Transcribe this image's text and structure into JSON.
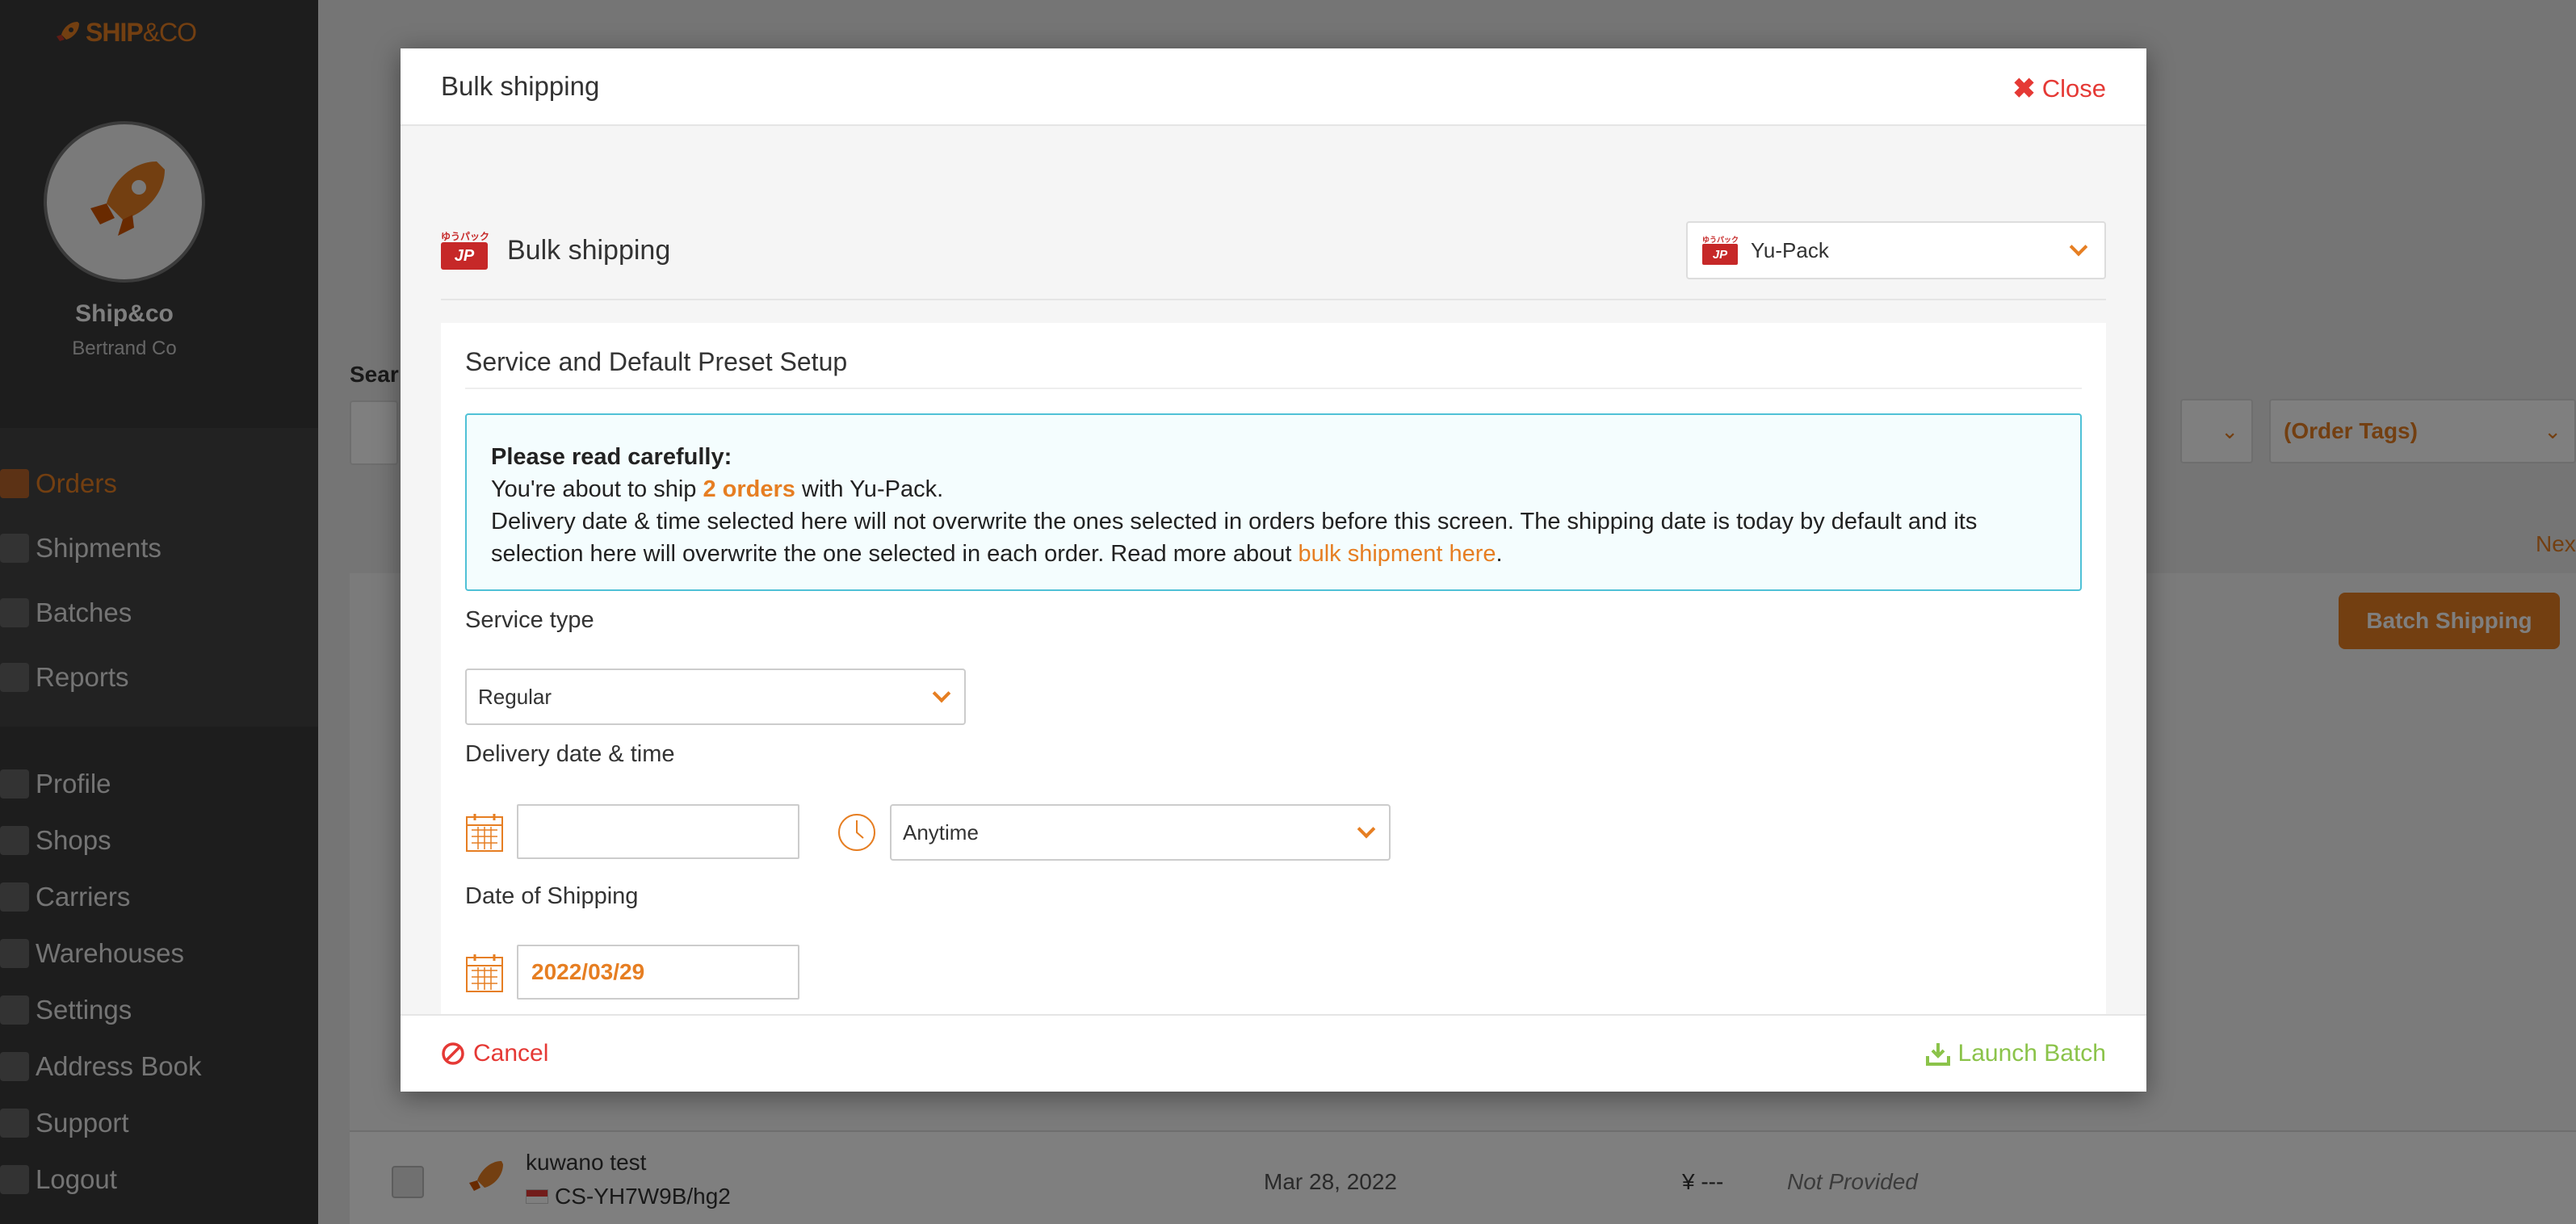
{
  "sidebar": {
    "logo_text_bold": "SHIP",
    "logo_text_rest": "&CO",
    "shop_name": "Ship&co",
    "shop_owner": "Bertrand Co",
    "nav_primary": [
      {
        "label": "Orders",
        "icon": "orders-icon",
        "active": true
      },
      {
        "label": "Shipments",
        "icon": "box-icon"
      },
      {
        "label": "Batches",
        "icon": "batch-icon"
      },
      {
        "label": "Reports",
        "icon": "report-icon"
      }
    ],
    "nav_secondary": [
      {
        "label": "Profile",
        "icon": "user-icon"
      },
      {
        "label": "Shops",
        "icon": "shop-icon"
      },
      {
        "label": "Carriers",
        "icon": "truck-icon"
      },
      {
        "label": "Warehouses",
        "icon": "warehouse-icon"
      },
      {
        "label": "Settings",
        "icon": "gear-icon"
      },
      {
        "label": "Address Book",
        "icon": "book-icon"
      },
      {
        "label": "Support",
        "icon": "help-icon"
      },
      {
        "label": "Logout",
        "icon": "logout-icon"
      }
    ]
  },
  "background": {
    "search_label": "Sear",
    "order_tags_placeholder": "(Order Tags)",
    "batch_shipping_label": "Batch Shipping",
    "next_label": "Nex",
    "order_row": {
      "name": "kuwano test",
      "code": "CS-YH7W9B/hg2",
      "date": "Mar 28, 2022",
      "price": "¥ ---",
      "status": "Not Provided"
    }
  },
  "modal": {
    "title": "Bulk shipping",
    "close_label": "Close",
    "carrier_heading": "Bulk shipping",
    "carrier_logo_top": "ゆうパック",
    "carrier_logo_box": "JP",
    "carrier_selected": "Yu-Pack",
    "section_title": "Service and Default Preset Setup",
    "notice": {
      "heading": "Please read carefully:",
      "line1_pre": "You're about to ship ",
      "line1_orders": "2 orders",
      "line1_post": " with Yu-Pack.",
      "line2_pre": "Delivery date & time selected here will not overwrite the ones selected in orders before this screen. The shipping date is today by default and its selection here will overwrite the one selected in each order. Read more about ",
      "line2_link": "bulk shipment here",
      "line2_post": "."
    },
    "service_type_label": "Service type",
    "service_type_value": "Regular",
    "delivery_label": "Delivery date & time",
    "delivery_date_value": "",
    "delivery_time_value": "Anytime",
    "shipping_date_label": "Date of Shipping",
    "shipping_date_value": "2022/03/29",
    "cancel_label": "Cancel",
    "launch_label": "Launch Batch"
  },
  "colors": {
    "accent": "#e67e22",
    "danger": "#e53935",
    "success": "#8bc34a",
    "info_border": "#4fc1d6",
    "sidebar_bg": "#3a3a3a"
  }
}
